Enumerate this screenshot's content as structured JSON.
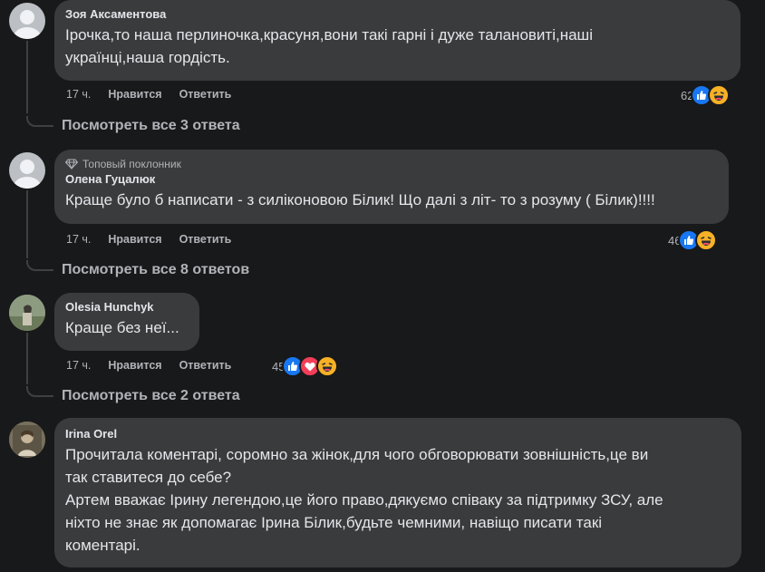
{
  "colors": {
    "background": "#18191a",
    "bubble": "#3a3b3c",
    "text": "#e4e6eb",
    "secondary": "#b0b3b8",
    "like": "#1877f2",
    "love": "#f33e58",
    "haha": "#f7b125"
  },
  "actions": {
    "like": "Нравится",
    "reply": "Ответить"
  },
  "comments": [
    {
      "author": "Зоя Аксаментова",
      "text": "Ірочка,то наша перлиночка,красуня,вони такі гарні і дуже талановиті,наші\nукраїнці,наша гордість.",
      "time": "17 ч.",
      "reaction_count": "62",
      "reaction_icons": [
        "like-icon",
        "haha-icon"
      ],
      "view_replies": "Посмотреть все 3 ответа"
    },
    {
      "badge": "Топовый поклонник",
      "author": "Олена Гуцалюк",
      "text": "Краще було б написати - з силіконовою Білик! Що далі з літ- то з розуму ( Білик)!!!!",
      "time": "17 ч.",
      "reaction_count": "46",
      "reaction_icons": [
        "like-icon",
        "haha-icon"
      ],
      "view_replies": "Посмотреть все 8 ответов"
    },
    {
      "author": "Olesia Hunchyk",
      "text": "Краще без неї...",
      "time": "17 ч.",
      "reaction_count": "45",
      "reaction_icons": [
        "like-icon",
        "love-icon",
        "haha-icon"
      ],
      "view_replies": "Посмотреть все 2 ответа"
    },
    {
      "author": "Irina Orel",
      "text": "Прочитала коментарі, соромно за жінок,для чого обговорювати зовнішність,це ви\nтак ставитеся до себе?\nАртем вважає Ірину легендою,це його право,дякуємо співаку за підтримку ЗСУ, але\nніхто не знає як допомагає Ірина Білик,будьте чемними, навіщо писати такі\nкоментарі."
    }
  ]
}
